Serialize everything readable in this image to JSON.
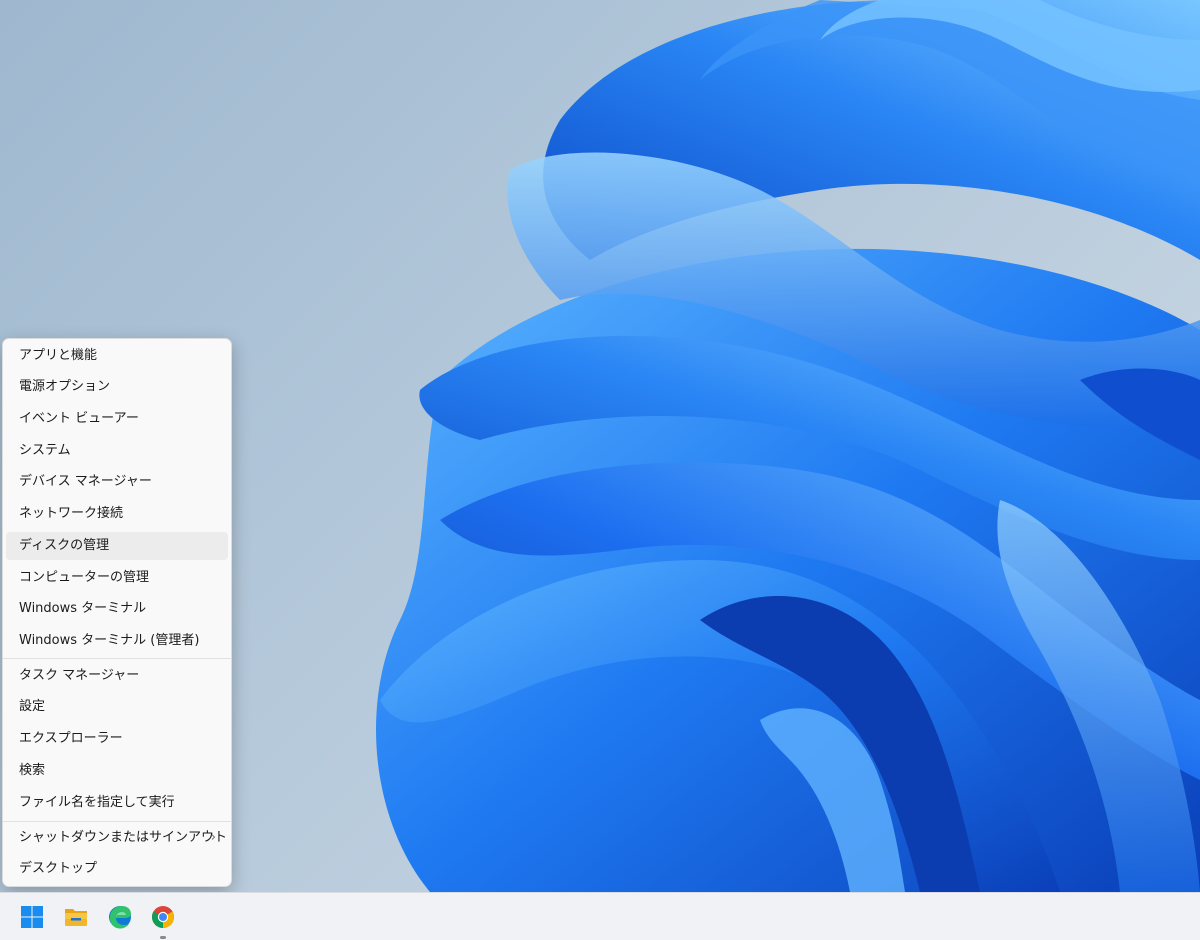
{
  "menu": {
    "items": [
      {
        "label": "アプリと機能"
      },
      {
        "label": "電源オプション"
      },
      {
        "label": "イベント ビューアー"
      },
      {
        "label": "システム"
      },
      {
        "label": "デバイス マネージャー"
      },
      {
        "label": "ネットワーク接続"
      },
      {
        "label": "ディスクの管理"
      },
      {
        "label": "コンピューターの管理"
      },
      {
        "label": "Windows ターミナル"
      },
      {
        "label": "Windows ターミナル (管理者)"
      },
      {
        "label": "タスク マネージャー"
      },
      {
        "label": "設定"
      },
      {
        "label": "エクスプローラー"
      },
      {
        "label": "検索"
      },
      {
        "label": "ファイル名を指定して実行"
      },
      {
        "label": "シャットダウンまたはサインアウト",
        "submenu_icon": "chevron-right-icon"
      },
      {
        "label": "デスクトップ"
      }
    ],
    "hovered_item": "ディスクの管理"
  },
  "taskbar": {
    "icons": [
      "windows-start-icon",
      "file-explorer-icon",
      "edge-browser-icon",
      "chrome-browser-icon"
    ],
    "running_app": "chrome-browser-icon"
  },
  "colors": {
    "wallpaper_blue": "#1e78f0",
    "menu_background": "#f9f9f9",
    "taskbar_background": "#f0f2f5"
  }
}
